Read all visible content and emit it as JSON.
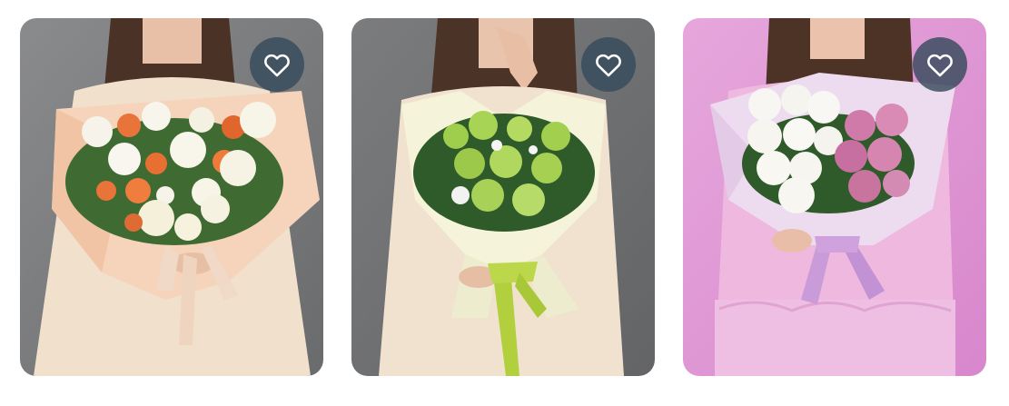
{
  "products": [
    {
      "id": "bouquet-1",
      "photo_theme": "white-orange-roses",
      "background": "#77787a",
      "wrap": "#f6d4bb",
      "dress": "#f1e0cb",
      "ribbon": "#f0d9c6",
      "favorite_icon": "heart-outline-icon"
    },
    {
      "id": "bouquet-2",
      "photo_theme": "green-roses",
      "background": "#6d6e70",
      "wrap": "#f5f3d9",
      "dress": "#f1e2cf",
      "ribbon": "#b2d03e",
      "favorite_icon": "heart-outline-icon"
    },
    {
      "id": "bouquet-3",
      "photo_theme": "white-pink-roses",
      "background": "#e39bd7",
      "wrap": "#eddcef",
      "dress": "#eeb8df",
      "ribbon": "#c99bd9",
      "favorite_icon": "heart-outline-icon"
    }
  ],
  "colors": {
    "favorite_button_bg": "#364b5c",
    "favorite_heart": "#ffffff"
  }
}
